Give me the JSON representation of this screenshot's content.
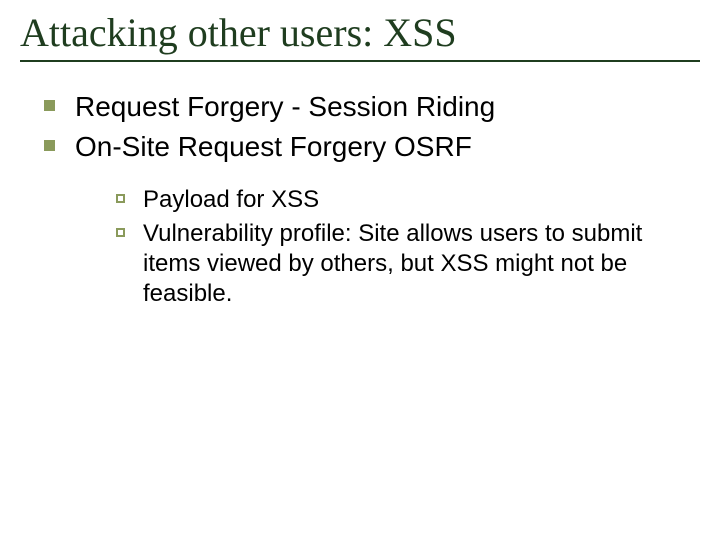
{
  "title": "Attacking other users: XSS",
  "bullets": {
    "bullet1": "Request Forgery - Session Riding",
    "bullet2": "On-Site Request Forgery OSRF"
  },
  "subbullets": {
    "sub1": "Payload for XSS",
    "sub2": "Vulnerability profile: Site allows users to submit items viewed by others, but XSS might not be feasible."
  }
}
